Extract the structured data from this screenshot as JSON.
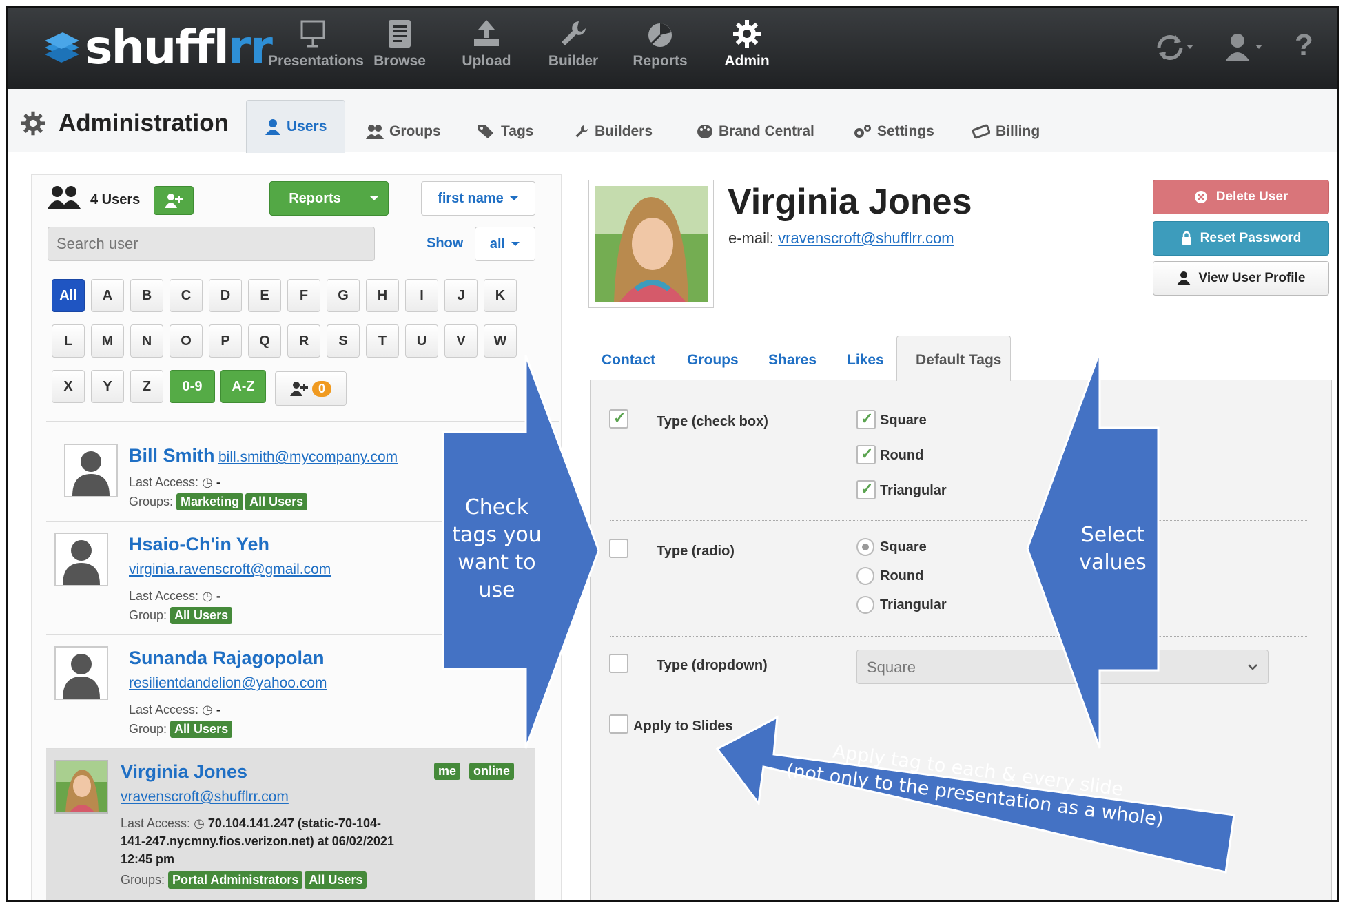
{
  "app": {
    "name_main": "shuffl",
    "name_accent": "rr"
  },
  "nav": [
    {
      "label": "Presentations",
      "icon": "presentation-icon"
    },
    {
      "label": "Browse",
      "icon": "browse-icon"
    },
    {
      "label": "Upload",
      "icon": "upload-icon"
    },
    {
      "label": "Builder",
      "icon": "wrench-icon"
    },
    {
      "label": "Reports",
      "icon": "pie-chart-icon"
    },
    {
      "label": "Admin",
      "icon": "gear-icon",
      "active": true
    }
  ],
  "tools": {
    "refresh": "refresh-icon",
    "user": "user-icon",
    "help": "?"
  },
  "admin": {
    "title": "Administration",
    "tabs": [
      {
        "label": "Users",
        "icon": "user-icon",
        "active": true
      },
      {
        "label": "Groups",
        "icon": "group-icon"
      },
      {
        "label": "Tags",
        "icon": "tags-icon"
      },
      {
        "label": "Builders",
        "icon": "wrench-icon"
      },
      {
        "label": "Brand Central",
        "icon": "palette-icon"
      },
      {
        "label": "Settings",
        "icon": "cogs-icon"
      },
      {
        "label": "Billing",
        "icon": "ticket-icon"
      }
    ]
  },
  "users_panel": {
    "count": "4 Users",
    "reports_label": "Reports",
    "sort_label": "first name",
    "search_placeholder": "Search user",
    "show_label": "Show",
    "show_value": "all",
    "letters_row1": [
      "All",
      "A",
      "B",
      "C",
      "D",
      "E",
      "F",
      "G",
      "H",
      "I",
      "J",
      "K"
    ],
    "letters_row2": [
      "L",
      "M",
      "N",
      "O",
      "P",
      "Q",
      "R",
      "S",
      "T",
      "U",
      "V",
      "W"
    ],
    "letters_row3": [
      "X",
      "Y",
      "Z",
      "0-9",
      "A-Z"
    ],
    "pending_count": "0",
    "last_access_label": "Last Access:",
    "users": [
      {
        "name": "Bill Smith",
        "email": "bill.smith@mycompany.com",
        "last_access": "-",
        "groups_label": "Groups:",
        "groups": [
          "Marketing",
          "All Users"
        ]
      },
      {
        "name": "Hsaio-Ch'in Yeh",
        "email": "virginia.ravenscroft@gmail.com",
        "last_access": "-",
        "groups_label": "Group:",
        "groups": [
          "All Users"
        ]
      },
      {
        "name": "Sunanda Rajagopolan",
        "email": "resilientdandelion@yahoo.com",
        "last_access": "-",
        "groups_label": "Group:",
        "groups": [
          "All Users"
        ]
      },
      {
        "name": "Virginia Jones",
        "email": "vravenscroft@shufflrr.com",
        "last_access_l1": "70.104.141.247 (static-70-104-",
        "last_access_l2": "141-247.nycmny.fios.verizon.net) at 06/02/2021",
        "last_access_l3": "12:45 pm",
        "groups_label": "Groups:",
        "groups": [
          "Portal Administrators",
          "All Users"
        ],
        "badges": [
          "me",
          "online"
        ]
      }
    ]
  },
  "profile": {
    "name": "Virginia Jones",
    "email_label": "e-mail:",
    "email": "vravenscroft@shufflrr.com",
    "delete_label": "Delete User",
    "reset_label": "Reset Password",
    "view_label": "View User Profile",
    "tabs": [
      "Contact",
      "Groups",
      "Shares",
      "Likes",
      "Default Tags"
    ],
    "tags": [
      {
        "label": "Type (check box)",
        "options": [
          "Square",
          "Round",
          "Triangular"
        ]
      },
      {
        "label": "Type (radio)",
        "options": [
          "Square",
          "Round",
          "Triangular"
        ]
      },
      {
        "label": "Type (dropdown)",
        "selected": "Square"
      }
    ],
    "apply_label": "Apply to Slides"
  },
  "callouts": {
    "left": [
      "Check",
      "tags you",
      "want to",
      "use"
    ],
    "right": [
      "Select",
      "values"
    ],
    "bottom": [
      "Apply tag to each & every slide",
      "(not only to the presentation as a whole)"
    ]
  },
  "colors": {
    "accent_blue": "#1f6fc4",
    "callout": "#4472c4",
    "green": "#53a845",
    "danger": "#d9757a",
    "info": "#3d9cbc"
  }
}
